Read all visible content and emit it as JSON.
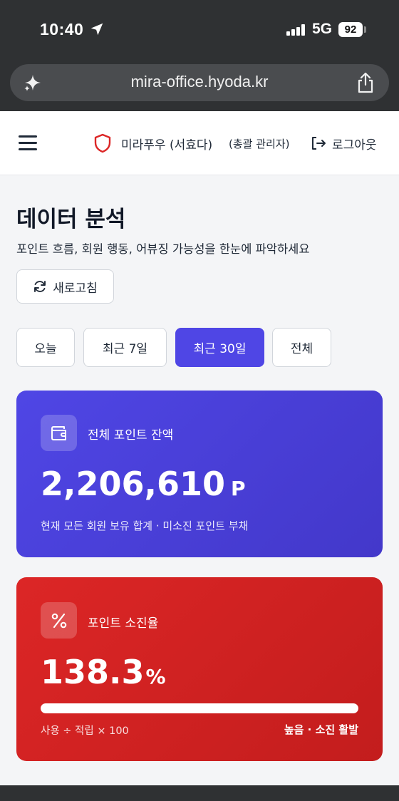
{
  "status_bar": {
    "time": "10:40",
    "network": "5G",
    "battery": "92"
  },
  "browser": {
    "url": "mira-office.hyoda.kr"
  },
  "header": {
    "user_name": "미라푸우 (서효다)",
    "user_role": "(총괄 관리자)",
    "logout_label": "로그아웃"
  },
  "page": {
    "title": "데이터 분석",
    "subtitle": "포인트 흐름, 회원 행동, 어뷰징 가능성을 한눈에 파악하세요",
    "refresh_label": "새로고침"
  },
  "ranges": {
    "tabs": [
      {
        "label": "오늘",
        "active": false
      },
      {
        "label": "최근 7일",
        "active": false
      },
      {
        "label": "최근 30일",
        "active": true
      },
      {
        "label": "전체",
        "active": false
      }
    ]
  },
  "balance_card": {
    "label": "전체 포인트 잔액",
    "value": "2,206,610",
    "unit": "P",
    "description": "현재 모든 회원 보유 합계 · 미소진 포인트 부채",
    "color": "#4f46e5"
  },
  "burn_card": {
    "label": "포인트 소진율",
    "value": "138.3",
    "unit": "%",
    "progress_percent": 100,
    "formula": "사용 ÷ 적립 × 100",
    "status": "높음 · 소진 활발",
    "color": "#dc2626"
  },
  "icons": {
    "status": [
      "location-arrow-icon",
      "signal-icon",
      "battery-icon"
    ],
    "browser": [
      "sparkle-icon",
      "share-icon"
    ],
    "header": [
      "menu-icon",
      "shield-icon",
      "logout-icon"
    ],
    "page": [
      "refresh-icon",
      "wallet-icon",
      "percent-icon"
    ]
  }
}
